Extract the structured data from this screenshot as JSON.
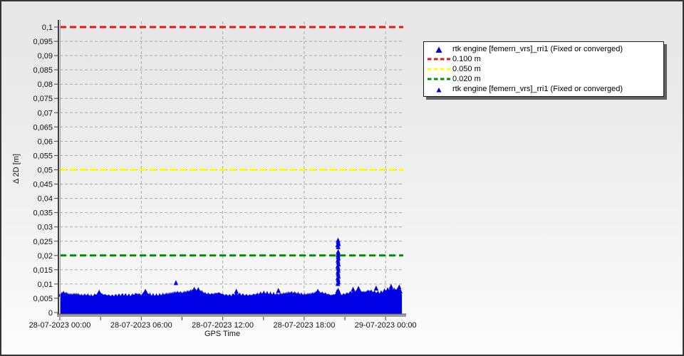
{
  "chart_data": {
    "type": "scatter",
    "title": "",
    "xlabel": "GPS Time",
    "ylabel": "Δ 2D [m]",
    "decimal_separator_axis": ",",
    "ylim": [
      0,
      0.1
    ],
    "y_tick_step": 0.005,
    "y_tick_labels": [
      "0,1",
      "0,095",
      "0,09",
      "0,085",
      "0,08",
      "0,075",
      "0,07",
      "0,065",
      "0,06",
      "0,055",
      "0,05",
      "0,045",
      "0,04",
      "0,035",
      "0,03",
      "0,025",
      "0,02",
      "0,015",
      "0,01",
      "0,005",
      "0"
    ],
    "x_range_hours": [
      0,
      25.3
    ],
    "x_ticks": [
      {
        "hours": 0,
        "label": "28-07-2023 00:00"
      },
      {
        "hours": 6,
        "label": "28-07-2023 06:00"
      },
      {
        "hours": 12,
        "label": "28-07-2023 12:00"
      },
      {
        "hours": 18,
        "label": "28-07-2023 18:00"
      },
      {
        "hours": 24,
        "label": "29-07-2023 00:00"
      }
    ],
    "x_minor_tick_hours": [
      3,
      9,
      15,
      21
    ],
    "grid": {
      "horizontal": true,
      "vertical": true,
      "style": "dashed"
    },
    "reference_lines": [
      {
        "label": "0.100 m",
        "value": 0.1,
        "color": "#e81313"
      },
      {
        "label": "0.050 m",
        "value": 0.05,
        "color": "#ffff00"
      },
      {
        "label": "0.020 m",
        "value": 0.02,
        "color": "#009100"
      }
    ],
    "series": [
      {
        "name": "rtk engine [femern_vrs]_rri1 (Fixed or converged)",
        "marker": "triangle",
        "color": "#0000e6",
        "description": "dense scatter band of epochs between 0 and ~0.008 m with a spike to ~0.026 m near 20:30",
        "band_envelope": [
          [
            0,
            0.006
          ],
          [
            0.2,
            0.0068
          ],
          [
            0.5,
            0.0064
          ],
          [
            0.8,
            0.006
          ],
          [
            1.2,
            0.0063
          ],
          [
            1.6,
            0.0059
          ],
          [
            2.0,
            0.0061
          ],
          [
            2.4,
            0.0058
          ],
          [
            2.9,
            0.0068
          ],
          [
            3.3,
            0.0062
          ],
          [
            3.8,
            0.0059
          ],
          [
            4.2,
            0.0061
          ],
          [
            4.7,
            0.0063
          ],
          [
            5.2,
            0.006
          ],
          [
            5.7,
            0.0066
          ],
          [
            6.0,
            0.0061
          ],
          [
            6.3,
            0.0072
          ],
          [
            6.7,
            0.006
          ],
          [
            7.2,
            0.0058
          ],
          [
            7.7,
            0.0061
          ],
          [
            8.2,
            0.0064
          ],
          [
            8.6,
            0.0068
          ],
          [
            9.0,
            0.0066
          ],
          [
            9.5,
            0.0072
          ],
          [
            9.9,
            0.0078
          ],
          [
            10.3,
            0.0076
          ],
          [
            10.7,
            0.0066
          ],
          [
            11.2,
            0.0064
          ],
          [
            11.7,
            0.0069
          ],
          [
            12.1,
            0.0062
          ],
          [
            12.6,
            0.006
          ],
          [
            13.0,
            0.0067
          ],
          [
            13.5,
            0.0062
          ],
          [
            14.0,
            0.006
          ],
          [
            14.5,
            0.0064
          ],
          [
            15.0,
            0.0069
          ],
          [
            15.5,
            0.0064
          ],
          [
            16.0,
            0.0061
          ],
          [
            16.5,
            0.0063
          ],
          [
            17.0,
            0.0067
          ],
          [
            17.5,
            0.0064
          ],
          [
            18.0,
            0.006
          ],
          [
            18.5,
            0.0064
          ],
          [
            19.0,
            0.0071
          ],
          [
            19.5,
            0.0067
          ],
          [
            20.0,
            0.006
          ],
          [
            20.3,
            0.0064
          ],
          [
            20.5,
            0.0088
          ],
          [
            20.7,
            0.0062
          ],
          [
            21.1,
            0.0066
          ],
          [
            21.6,
            0.0074
          ],
          [
            22.0,
            0.0078
          ],
          [
            22.4,
            0.0071
          ],
          [
            22.8,
            0.0077
          ],
          [
            23.2,
            0.0071
          ],
          [
            23.6,
            0.0067
          ],
          [
            24.0,
            0.0077
          ],
          [
            24.4,
            0.0081
          ],
          [
            24.8,
            0.0077
          ],
          [
            25.05,
            0.0083
          ],
          [
            25.2,
            0.006
          ]
        ],
        "outliers": [
          [
            8.55,
            0.0105
          ],
          [
            20.48,
            0.0102
          ],
          [
            20.52,
            0.0108
          ],
          [
            20.5,
            0.0115
          ],
          [
            20.47,
            0.0122
          ],
          [
            20.53,
            0.0128
          ],
          [
            20.5,
            0.0135
          ],
          [
            20.48,
            0.0142
          ],
          [
            20.52,
            0.0149
          ],
          [
            20.5,
            0.0156
          ],
          [
            20.47,
            0.0163
          ],
          [
            20.53,
            0.017
          ],
          [
            20.5,
            0.0177
          ],
          [
            20.48,
            0.0184
          ],
          [
            20.52,
            0.019
          ],
          [
            20.5,
            0.0196
          ],
          [
            20.49,
            0.0202
          ],
          [
            20.51,
            0.0208
          ],
          [
            20.5,
            0.0214
          ],
          [
            20.5,
            0.0231
          ],
          [
            20.46,
            0.0238
          ],
          [
            20.54,
            0.0242
          ],
          [
            20.5,
            0.0248
          ],
          [
            20.49,
            0.0254
          ],
          [
            2.9,
            0.0072
          ],
          [
            6.3,
            0.0075
          ],
          [
            9.9,
            0.0082
          ],
          [
            10.2,
            0.0081
          ],
          [
            13.0,
            0.0075
          ],
          [
            16.1,
            0.0078
          ],
          [
            19.0,
            0.0075
          ],
          [
            21.6,
            0.0082
          ],
          [
            22.0,
            0.0085
          ],
          [
            23.3,
            0.0086
          ],
          [
            24.4,
            0.0092
          ],
          [
            25.0,
            0.009
          ]
        ]
      }
    ],
    "legend": {
      "position": "top-right",
      "items": [
        {
          "marker": "triangle",
          "color": "#0000dd",
          "label": "rtk engine [femern_vrs]_rri1 (Fixed or converged)"
        },
        {
          "marker": "dash",
          "color": "#e81313",
          "label": "0.100 m"
        },
        {
          "marker": "dash",
          "color": "#ffff00",
          "label": "0.050 m"
        },
        {
          "marker": "dash",
          "color": "#009100",
          "label": "0.020 m"
        },
        {
          "marker": "triangle-small",
          "color": "#0000dd",
          "label": "rtk engine [femern_vrs]_rri1 (Fixed or converged)"
        }
      ]
    }
  }
}
